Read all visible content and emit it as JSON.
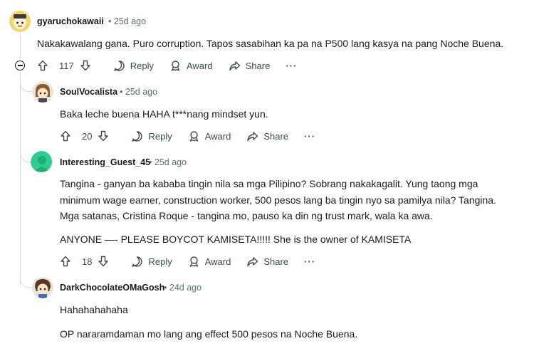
{
  "comments": [
    {
      "username": "gyaruchokawaii",
      "age": "25d ago",
      "lines": [
        "Nakakawalang gana. Puro corruption. Tapos sasabihan ka pa na P500 lang kasya na pang Noche Buena."
      ],
      "votes": "117",
      "reply_label": "Reply",
      "award_label": "Award",
      "share_label": "Share",
      "more_label": "···"
    },
    {
      "username": "SoulVocalista",
      "age": "25d ago",
      "lines": [
        "Baka leche buena HAHA t***nang mindset yun."
      ],
      "votes": "20",
      "reply_label": "Reply",
      "award_label": "Award",
      "share_label": "Share",
      "more_label": "···"
    },
    {
      "username": "Interesting_Guest_45",
      "age": "25d ago",
      "lines": [
        "Tangina - ganyan ba kababa tingin nila sa mga Pilipino? Sobrang nakakagalit. Yung taong mga",
        "minimum wage earner, construction worker, 500 pesos lang ba tingin nyo sa pamilya nila? Tangina.",
        "Mga satanas, Cristina Roque - tangina mo, pauso ka din ng trust mark, wala ka awa.",
        "ANYONE —- PLEASE BOYCOT KAMISETA!!!!! She is the owner of KAMISETA"
      ],
      "votes": "18",
      "reply_label": "Reply",
      "award_label": "Award",
      "share_label": "Share",
      "more_label": "···"
    },
    {
      "username": "DarkChocolateOMaGosh",
      "age": "24d ago",
      "lines": [
        "Hahahahahaha",
        "OP nararamdaman mo lang ang effect 500 pesos na Noche Buena."
      ]
    }
  ],
  "separator": "•",
  "icons": {
    "upvote": "arrow-up-icon",
    "downvote": "arrow-down-icon",
    "reply": "speech-bubble-icon",
    "award": "award-ribbon-icon",
    "share": "share-arrow-icon",
    "collapse": "collapse-minus-icon"
  },
  "colors": {
    "text": "#1a1a1b",
    "meta": "#576f76",
    "thread": "#d7dce0",
    "avatar_green": "#2ecc8f"
  }
}
